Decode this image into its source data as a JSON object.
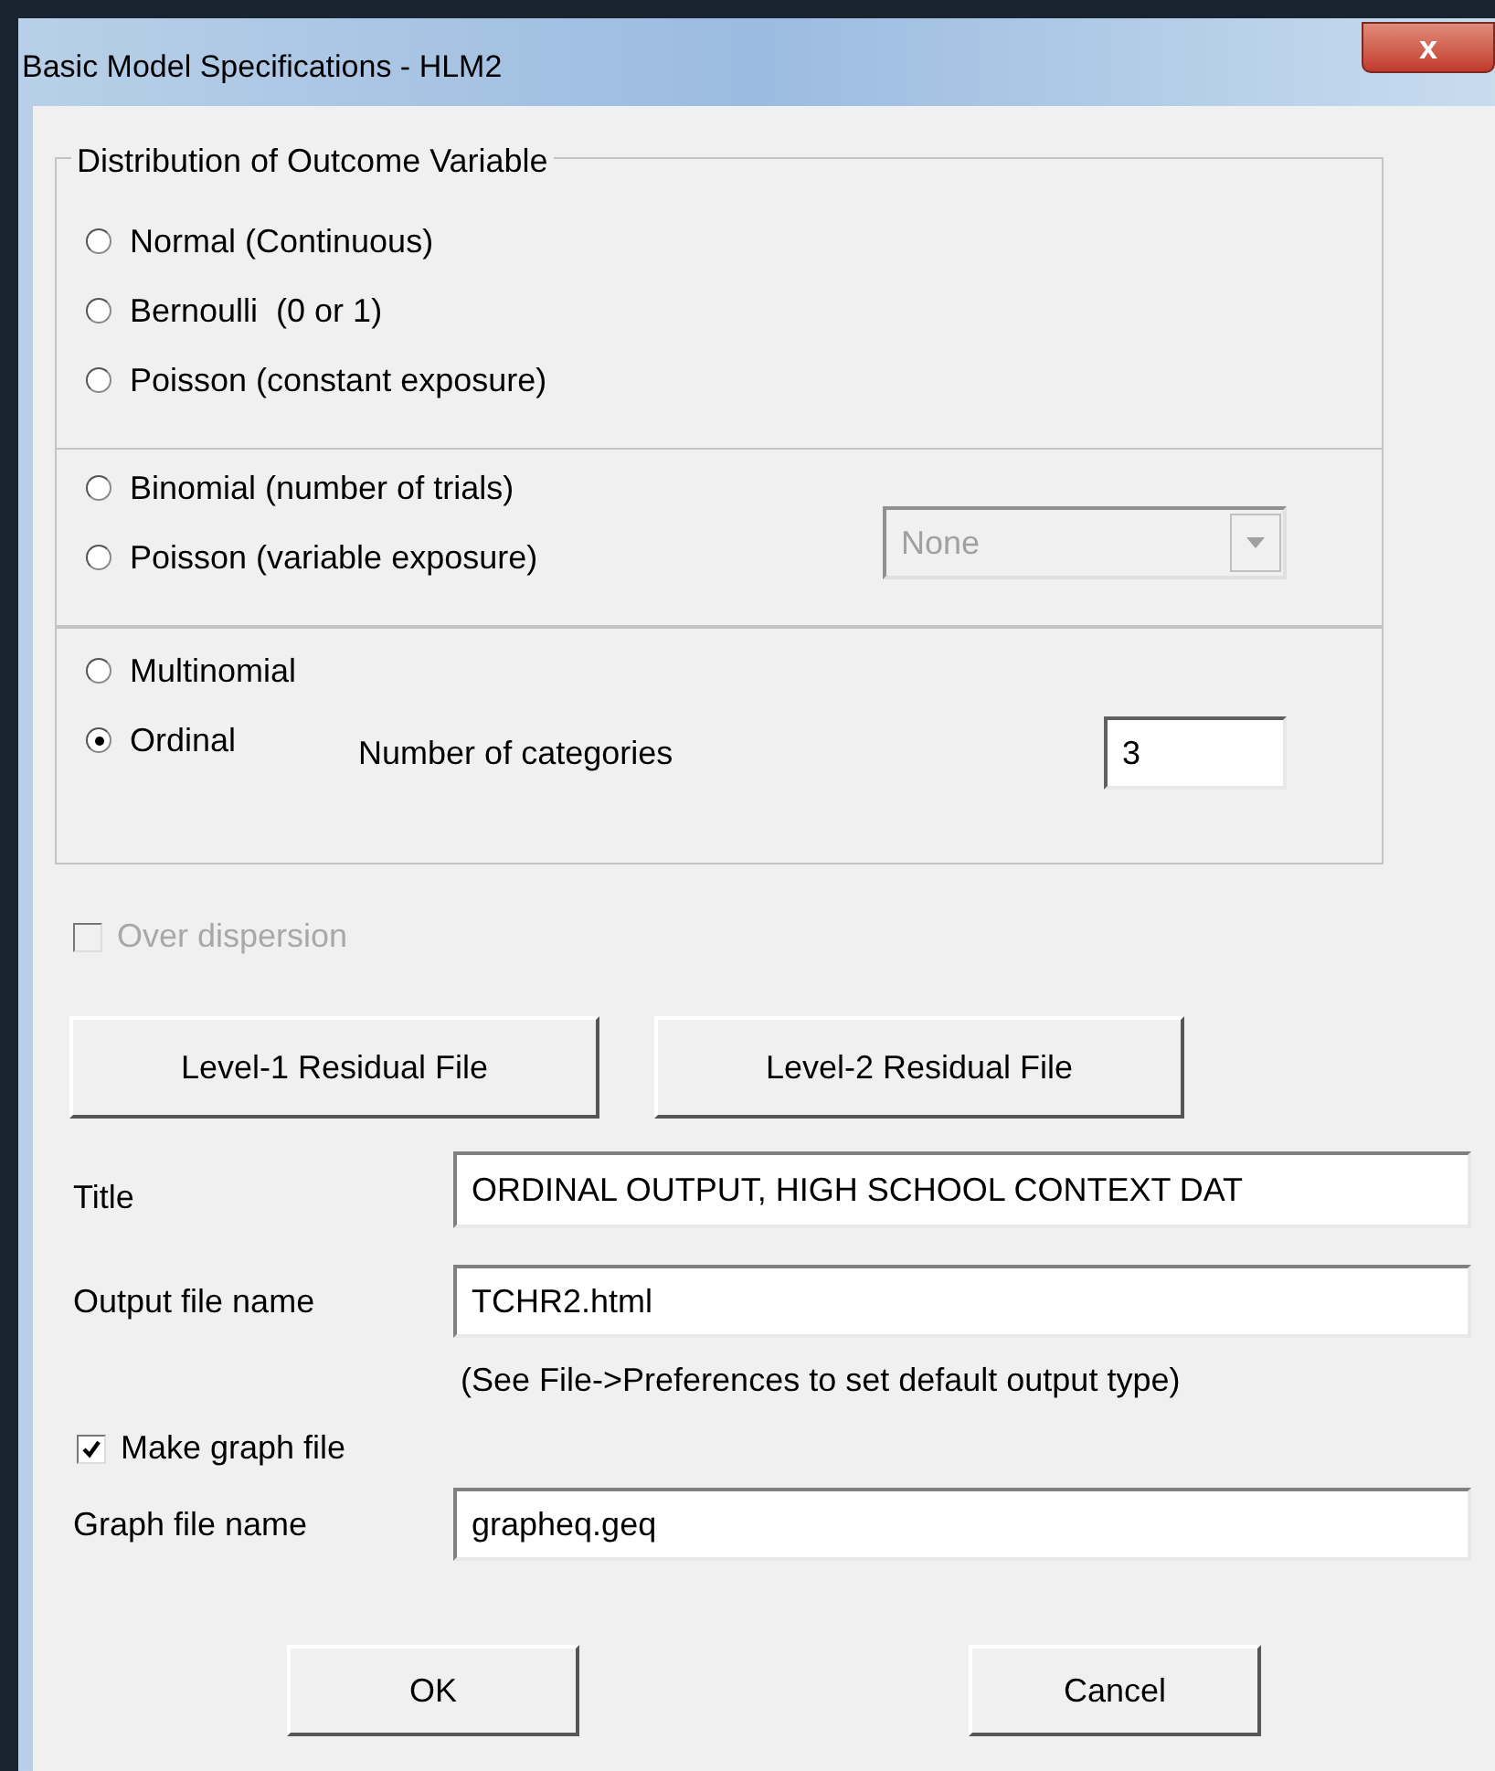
{
  "window": {
    "title": "Basic Model Specifications - HLM2",
    "close": "x"
  },
  "distribution": {
    "title": "Distribution of Outcome Variable",
    "groups": [
      {
        "options": [
          {
            "label": "Normal (Continuous)",
            "selected": false
          },
          {
            "label": "Bernoulli  (0 or 1)",
            "selected": false
          },
          {
            "label": "Poisson (constant exposure)",
            "selected": false
          }
        ]
      },
      {
        "options": [
          {
            "label": "Binomial (number of trials)",
            "selected": false
          },
          {
            "label": "Poisson (variable exposure)",
            "selected": false
          }
        ],
        "dropdown": {
          "value": "None",
          "disabled": true
        }
      },
      {
        "options": [
          {
            "label": "Multinomial",
            "selected": false
          },
          {
            "label": "Ordinal",
            "selected": true
          }
        ],
        "field": {
          "label": "Number of categories",
          "value": "3"
        }
      }
    ]
  },
  "over_dispersion": {
    "label": "Over dispersion",
    "checked": false,
    "disabled": true
  },
  "residual_buttons": [
    "Level-1 Residual File",
    "Level-2 Residual File"
  ],
  "title_field": {
    "label": "Title",
    "value": "ORDINAL OUTPUT, HIGH SCHOOL CONTEXT DAT"
  },
  "output_field": {
    "label": "Output file name",
    "value": "TCHR2.html"
  },
  "output_hint": "(See File->Preferences to set default output type)",
  "make_graph": {
    "label": "Make graph file",
    "checked": true,
    "disabled": false
  },
  "graph_field": {
    "label": "Graph file name",
    "value": "grapheq.geq"
  },
  "buttons": [
    "OK",
    "Cancel"
  ]
}
